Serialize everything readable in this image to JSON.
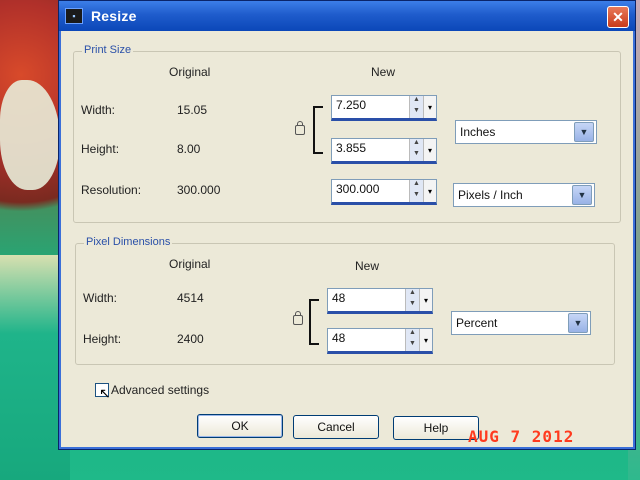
{
  "window": {
    "title": "Resize",
    "close_symbol": "✕"
  },
  "print_size": {
    "group_title": "Print Size",
    "col_original": "Original",
    "col_new": "New",
    "width": {
      "label": "Width:",
      "original": "15.05",
      "new": "7.250"
    },
    "height": {
      "label": "Height:",
      "original": "8.00",
      "new": "3.855"
    },
    "resolution": {
      "label": "Resolution:",
      "original": "300.000",
      "new": "300.000"
    },
    "units": "Inches",
    "resolution_units": "Pixels / Inch"
  },
  "pixel_dimensions": {
    "group_title": "Pixel Dimensions",
    "col_original": "Original",
    "col_new": "New",
    "width": {
      "label": "Width:",
      "original": "4514",
      "new": "48"
    },
    "height": {
      "label": "Height:",
      "original": "2400",
      "new": "48"
    },
    "units": "Percent"
  },
  "advanced_settings": {
    "label": "Advanced settings",
    "checked": false
  },
  "buttons": {
    "ok": "OK",
    "cancel": "Cancel",
    "help": "Help"
  },
  "datestamp": "AUG  7 2012",
  "colors": {
    "titlebar": "#1f5ccc",
    "dialog_bg": "#ece9d8",
    "group_title": "#2a50a8",
    "datestamp": "#ff3a1e"
  }
}
